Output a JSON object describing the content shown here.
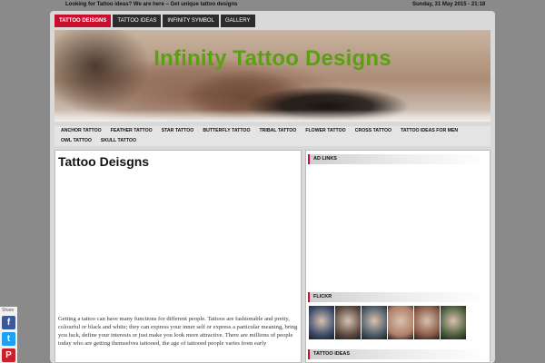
{
  "topbar": {
    "tagline": "Looking for Tattoo ideas? We are here – Get unique tattoo designs",
    "date": "Sunday, 31 May 2015 - 21:18"
  },
  "top_nav": [
    {
      "label": "Tattoo Deisgns",
      "active": true
    },
    {
      "label": "Tattoo Ideas",
      "active": false
    },
    {
      "label": "Infinity Symbol",
      "active": false
    },
    {
      "label": "Gallery",
      "active": false
    }
  ],
  "header": {
    "site_title": "Infinity Tattoo Designs"
  },
  "main_nav": [
    "Anchor Tattoo",
    "Feather Tattoo",
    "Star Tattoo",
    "Butterfly Tattoo",
    "Tribal Tattoo",
    "Flower Tattoo",
    "Cross Tattoo",
    "Tattoo Ideas for Men",
    "Owl Tattoo",
    "Skull Tattoo"
  ],
  "content": {
    "heading": "Tattoo Deisgns",
    "paragraph": "Getting a tattoo can have many functions for different people. Tattoos are fashionable and pretty, colourful or black and white; they can express your inner self or express a particular meaning, bring you luck, define your interests or just make you look more attractive. There are millions of people today who are getting themselves tattooed, the age of tattooed people varies from early"
  },
  "sidebar": {
    "ad_title": "AD LINKS",
    "flickr_title": "FLICKR",
    "ideas_title": "TATTOO IDEAS",
    "thumbs": [
      {
        "label": "tattoo-photo-1",
        "color": "#3a4a6a"
      },
      {
        "label": "tattoo-photo-2",
        "color": "#5c4a40"
      },
      {
        "label": "tattoo-photo-3",
        "color": "#4a5a66"
      },
      {
        "label": "tattoo-photo-4",
        "color": "#b07f68"
      },
      {
        "label": "tattoo-photo-5",
        "color": "#8a5a48"
      },
      {
        "label": "tattoo-photo-6",
        "color": "#4d5e3c"
      }
    ]
  },
  "share": {
    "label": "Share",
    "facebook": "f",
    "twitter": "t",
    "pinterest": "P"
  },
  "colors": {
    "accent": "#c8102e",
    "title_green": "#5aa012"
  }
}
